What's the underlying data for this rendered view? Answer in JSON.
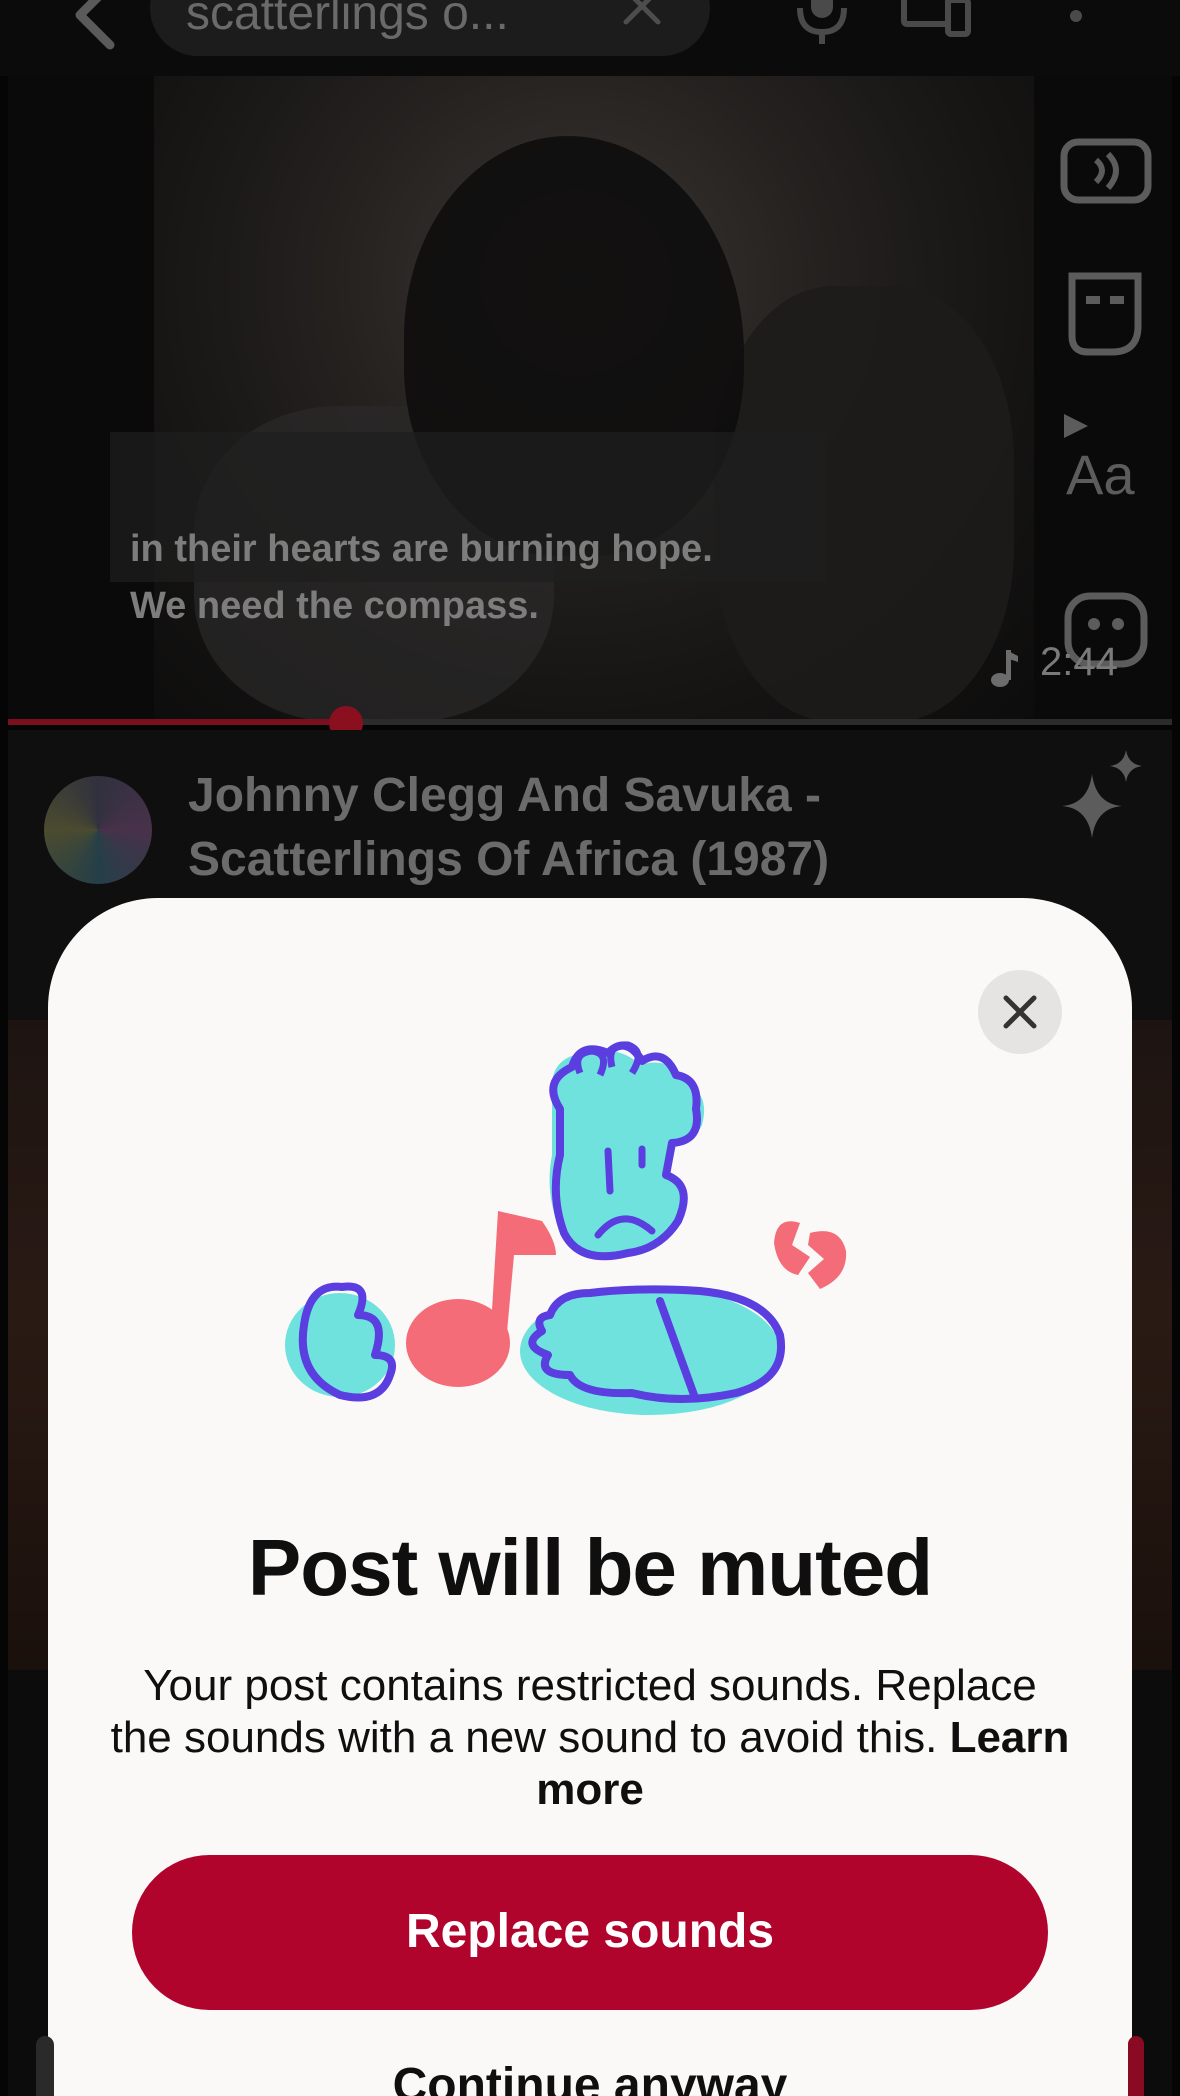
{
  "topbar": {
    "search_query": "scatterlings o..."
  },
  "video": {
    "captions": [
      "in their hearts are burning hope.",
      "We need the compass."
    ],
    "time_remaining": "2:44",
    "progress_fraction": 0.29,
    "title_line1": "Johnny Clegg And Savuka -",
    "title_line2": "Scatterlings Of Africa (1987)"
  },
  "side_rail": {
    "icons": [
      "sound-effect-icon",
      "sticker-icon",
      "text-icon",
      "face-filter-icon"
    ]
  },
  "sheet": {
    "title": "Post will be muted",
    "body": "Your post contains restricted sounds. Replace the sounds with a new sound to avoid this.",
    "learn_more": "Learn more",
    "primary_button": "Replace sounds",
    "secondary_button": "Continue anyway"
  },
  "colors": {
    "accent": "#b0042d",
    "illustration_fill": "#6fe2dd",
    "illustration_stroke": "#5a3ee0",
    "illustration_note": "#f46c78"
  }
}
